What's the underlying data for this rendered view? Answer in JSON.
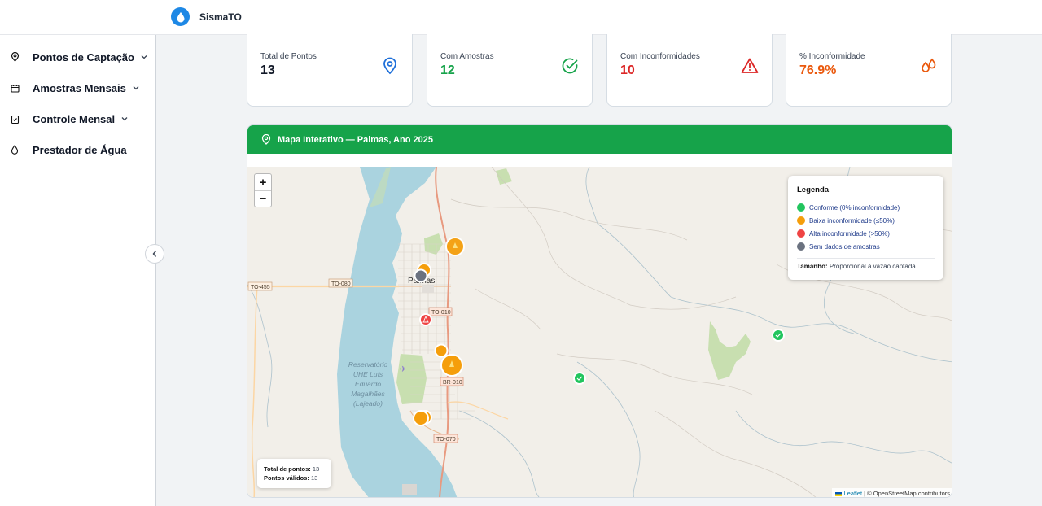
{
  "app": {
    "name": "SismaTO"
  },
  "sidebar": {
    "items": [
      {
        "label": "Pontos de Captação",
        "icon": "map-pin-icon",
        "has_submenu": true
      },
      {
        "label": "Amostras Mensais",
        "icon": "calendar-icon",
        "has_submenu": true
      },
      {
        "label": "Controle Mensal",
        "icon": "clipboard-check-icon",
        "has_submenu": true
      },
      {
        "label": "Prestador de Água",
        "icon": "droplet-icon",
        "has_submenu": false
      }
    ]
  },
  "cards": [
    {
      "label": "Total de Pontos",
      "value": "13",
      "color": "#111827",
      "icon": "map-pin-icon",
      "icon_color": "#1e6fd9"
    },
    {
      "label": "Com Amostras",
      "value": "12",
      "color": "#16a34a",
      "icon": "check-circle-icon",
      "icon_color": "#16a34a"
    },
    {
      "label": "Com Inconformidades",
      "value": "10",
      "color": "#dc2626",
      "icon": "warning-triangle-icon",
      "icon_color": "#dc2626"
    },
    {
      "label": "% Inconformidade",
      "value": "76.9%",
      "color": "#ea580c",
      "icon": "droplets-icon",
      "icon_color": "#ea580c"
    }
  ],
  "map": {
    "title": "Mapa Interativo — Palmas, Ano 2025",
    "header_color": "#16a34a",
    "zoom_in": "+",
    "zoom_out": "−",
    "legend": {
      "title": "Legenda",
      "items": [
        {
          "label": "Conforme (0% inconformidade)",
          "color": "#22c55e"
        },
        {
          "label": "Baixa inconformidade (≤50%)",
          "color": "#f59e0b"
        },
        {
          "label": "Alta inconformidade (>50%)",
          "color": "#ef4444"
        },
        {
          "label": "Sem dados de amostras",
          "color": "#6b7280"
        }
      ],
      "size_label": "Tamanho:",
      "size_text": "Proporcional à vazão captada"
    },
    "stats": {
      "total_label": "Total de pontos:",
      "total_value": "13",
      "valid_label": "Pontos válidos:",
      "valid_value": "13"
    },
    "labels": {
      "city": "Palmas",
      "reservoir": [
        "Reservatório",
        "UHE Luís",
        "Eduardo",
        "Magalhães",
        "(Lajeado)"
      ],
      "roads": [
        "TO-455",
        "TO-080",
        "TO-010",
        "BR-010",
        "TO-070"
      ]
    },
    "attribution": {
      "leaflet": "Leaflet",
      "osm": "| © OpenStreetMap contributors"
    }
  }
}
